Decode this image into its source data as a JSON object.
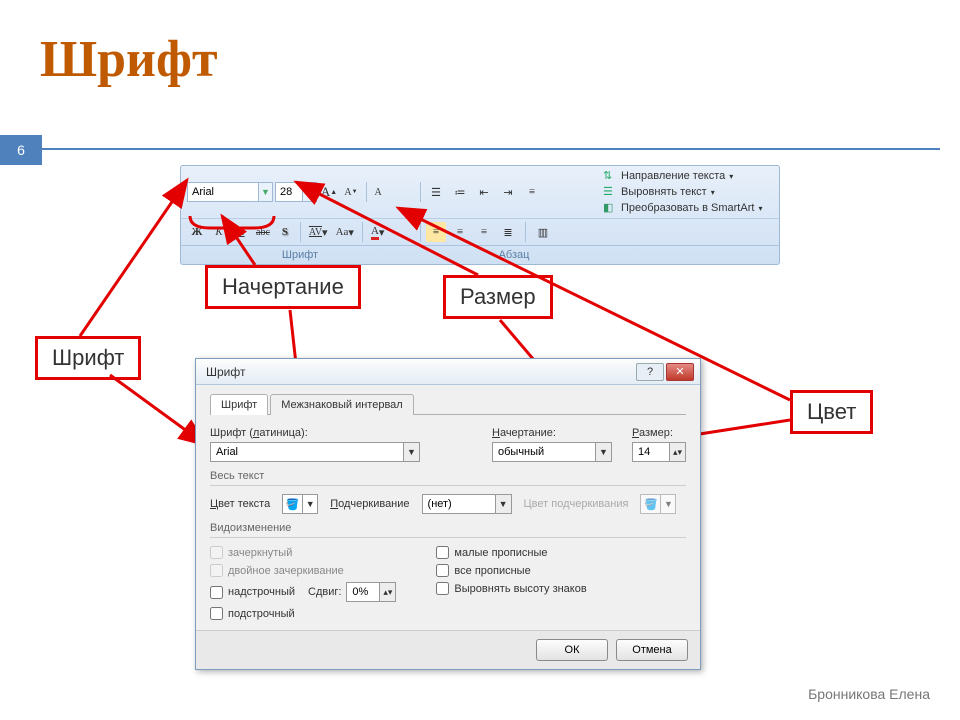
{
  "slide": {
    "title": "Шрифт",
    "page_number": "6",
    "author": "Бронникова Елена"
  },
  "callouts": {
    "font": "Шрифт",
    "style": "Начертание",
    "size": "Размер",
    "color": "Цвет"
  },
  "ribbon": {
    "font_name": "Arial",
    "font_size": "28",
    "label_font": "Шрифт",
    "label_para": "Абзац",
    "menu": {
      "text_direction": "Направление текста",
      "align_text": "Выровнять текст",
      "smartart": "Преобразовать в SmartArt"
    },
    "bold": "Ж",
    "italic": "К",
    "underline": "Ч",
    "strike": "abc",
    "shadow": "S",
    "kerning": "AV",
    "case": "Aa",
    "color_letter": "A"
  },
  "dialog": {
    "title": "Шрифт",
    "tab_font": "Шрифт",
    "tab_spacing": "Межзнаковый интервал",
    "lbl_font_latin_pre": "Шрифт (",
    "lbl_font_latin_u": "л",
    "lbl_font_latin_post": "атиница):",
    "lbl_style_u": "Н",
    "lbl_style_post": "ачертание:",
    "lbl_size_u": "Р",
    "lbl_size_post": "азмер:",
    "val_font": "Arial",
    "val_style": "обычный",
    "val_size": "14",
    "section_alltext": "Весь текст",
    "lbl_text_color_u": "Ц",
    "lbl_text_color_post": "вет текста",
    "lbl_underline_u": "П",
    "lbl_underline_mid": "одчеркивание",
    "val_underline": "(нет)",
    "lbl_underline_color": "Цвет подчеркивания",
    "section_effects": "Видоизменение",
    "chk_strike": "зачеркнутый",
    "chk_dblstrike": "двойное зачеркивание",
    "chk_super": "надстрочный",
    "chk_sub": "подстрочный",
    "chk_smallcaps": "малые прописные",
    "chk_allcaps": "все прописные",
    "chk_equalize": "Выровнять высоту знаков",
    "lbl_shift": "Сдвиг:",
    "val_shift": "0%",
    "btn_ok": "ОК",
    "btn_cancel": "Отмена"
  }
}
